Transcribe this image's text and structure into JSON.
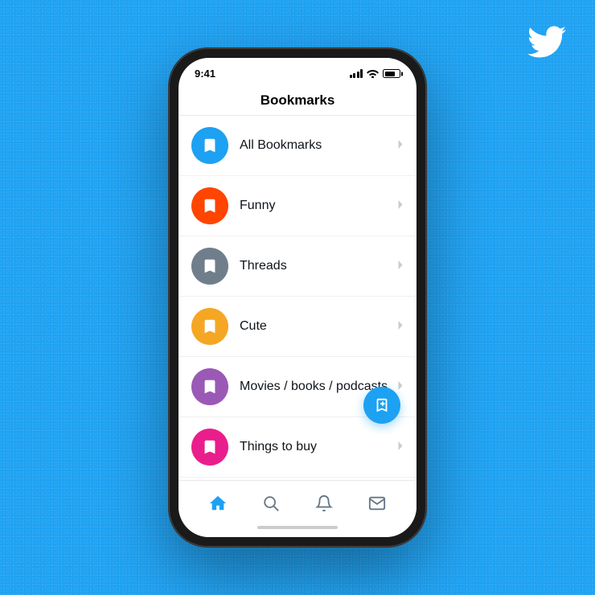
{
  "background": {
    "color": "#1DA1F2"
  },
  "twitter_logo": {
    "alt": "Twitter bird logo"
  },
  "status_bar": {
    "time": "9:41",
    "signal": "full",
    "wifi": "on",
    "battery": "charged"
  },
  "header": {
    "title": "Bookmarks"
  },
  "bookmarks": [
    {
      "id": 1,
      "label": "All Bookmarks",
      "icon_color": "#1DA1F2"
    },
    {
      "id": 2,
      "label": "Funny",
      "icon_color": "#FF4500"
    },
    {
      "id": 3,
      "label": "Threads",
      "icon_color": "#707E8C"
    },
    {
      "id": 4,
      "label": "Cute",
      "icon_color": "#F5A623"
    },
    {
      "id": 5,
      "label": "Movies / books / podcasts",
      "icon_color": "#9B59B6"
    },
    {
      "id": 6,
      "label": "Things to buy",
      "icon_color": "#E91E8C"
    }
  ],
  "fab": {
    "label": "Add bookmark folder"
  },
  "nav": {
    "items": [
      "home",
      "search",
      "notifications",
      "messages"
    ]
  }
}
